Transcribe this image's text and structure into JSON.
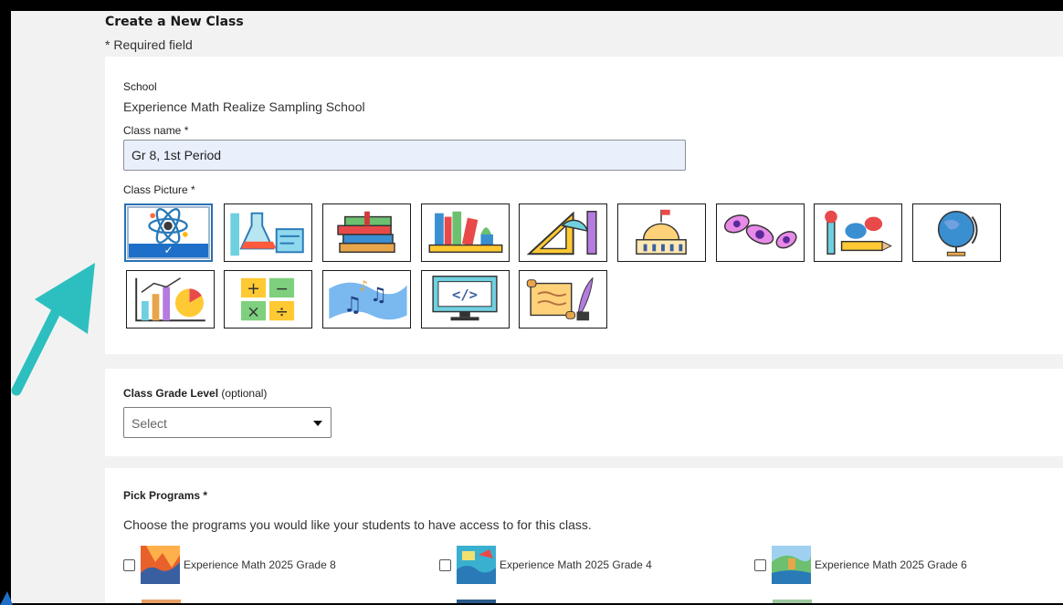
{
  "page": {
    "title": "Create a New Class",
    "required_note": "* Required field"
  },
  "school": {
    "label": "School",
    "value": "Experience Math Realize Sampling School"
  },
  "class_name": {
    "label": "Class name *",
    "value": "Gr 8, 1st Period"
  },
  "class_picture": {
    "label": "Class Picture *",
    "selected_check": "✓",
    "pictures": [
      {
        "icon": "atom-icon",
        "selected": true
      },
      {
        "icon": "lab-flask-icon",
        "selected": false
      },
      {
        "icon": "book-stack-icon",
        "selected": false
      },
      {
        "icon": "bookshelf-icon",
        "selected": false
      },
      {
        "icon": "geometry-tools-icon",
        "selected": false
      },
      {
        "icon": "capitol-building-icon",
        "selected": false
      },
      {
        "icon": "bacteria-icon",
        "selected": false
      },
      {
        "icon": "art-supplies-icon",
        "selected": false
      },
      {
        "icon": "globe-icon",
        "selected": false
      },
      {
        "icon": "bar-chart-icon",
        "selected": false
      },
      {
        "icon": "math-operations-icon",
        "selected": false
      },
      {
        "icon": "music-notes-icon",
        "selected": false
      },
      {
        "icon": "code-monitor-icon",
        "selected": false
      },
      {
        "icon": "scroll-quill-icon",
        "selected": false
      }
    ]
  },
  "grade_level": {
    "label": "Class Grade Level",
    "label_suffix": " (optional)",
    "select_value": "Select"
  },
  "programs": {
    "label": "Pick Programs *",
    "description": "Choose the programs you would like your students to have access to for this class.",
    "items": [
      {
        "name": "Experience Math 2025 Grade 8",
        "checked": false
      },
      {
        "name": "Experience Math 2025 Grade 4",
        "checked": false
      },
      {
        "name": "Experience Math 2025 Grade 6",
        "checked": false
      }
    ]
  },
  "colors": {
    "accent_arrow": "#2dbfbf",
    "selected_bar": "#1e6fc8",
    "input_bg": "#e9f0fc"
  }
}
